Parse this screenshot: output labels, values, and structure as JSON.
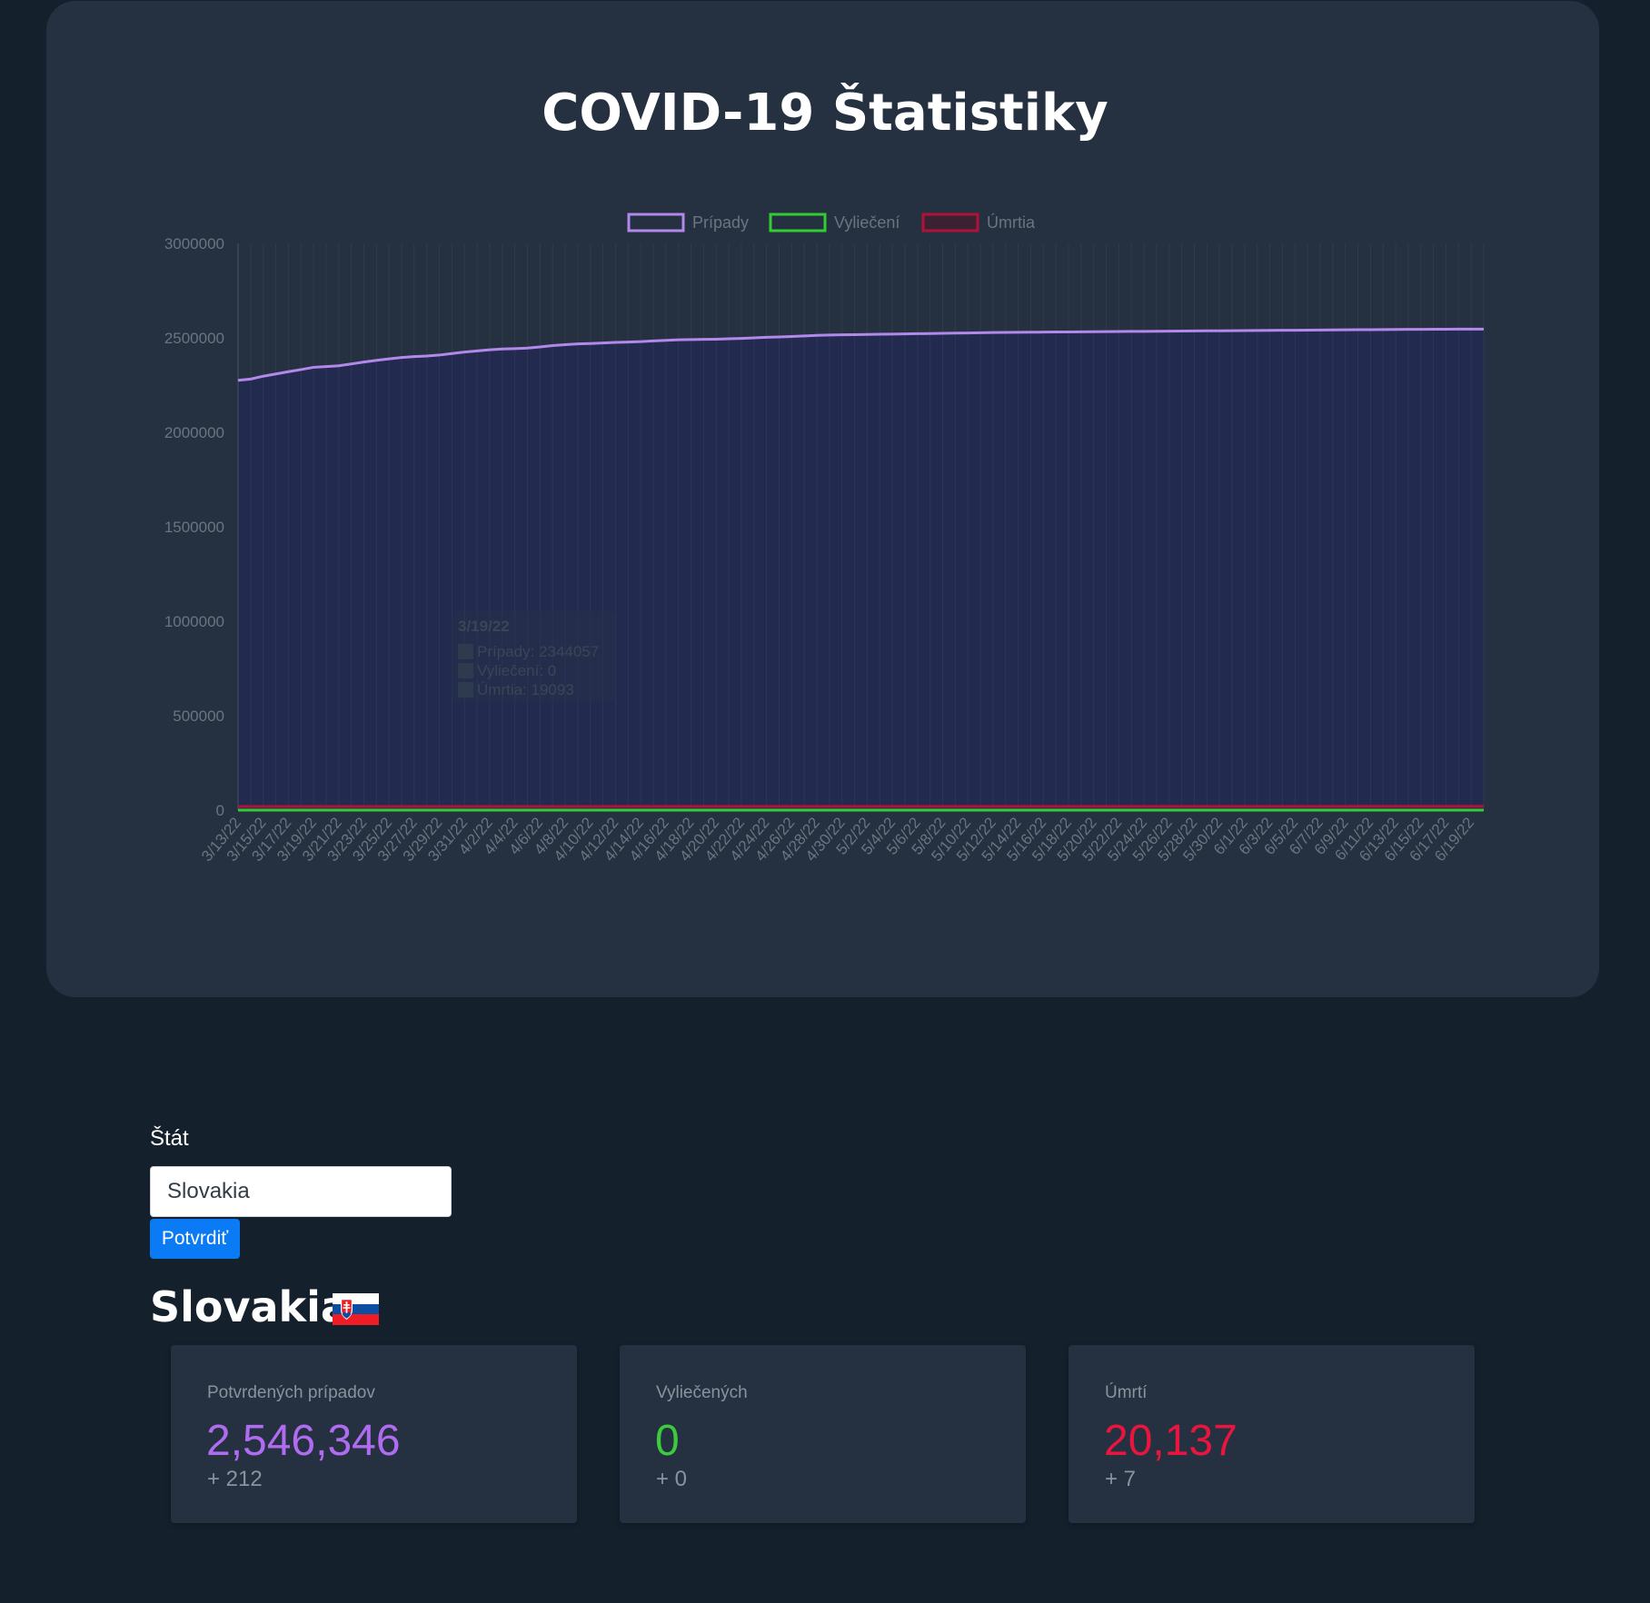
{
  "page": {
    "title": "COVID-19 Štatistiky"
  },
  "chart_data": {
    "type": "area",
    "legend_position": "top",
    "grid": true,
    "ylim": [
      0,
      3000000
    ],
    "yticks": [
      0,
      500000,
      1000000,
      1500000,
      2000000,
      2500000,
      3000000
    ],
    "x": [
      "3/13/22",
      "3/14/22",
      "3/15/22",
      "3/16/22",
      "3/17/22",
      "3/18/22",
      "3/19/22",
      "3/20/22",
      "3/21/22",
      "3/22/22",
      "3/23/22",
      "3/24/22",
      "3/25/22",
      "3/26/22",
      "3/27/22",
      "3/28/22",
      "3/29/22",
      "3/30/22",
      "3/31/22",
      "4/1/22",
      "4/2/22",
      "4/3/22",
      "4/4/22",
      "4/5/22",
      "4/6/22",
      "4/7/22",
      "4/8/22",
      "4/9/22",
      "4/10/22",
      "4/11/22",
      "4/12/22",
      "4/13/22",
      "4/14/22",
      "4/15/22",
      "4/16/22",
      "4/17/22",
      "4/18/22",
      "4/19/22",
      "4/20/22",
      "4/21/22",
      "4/22/22",
      "4/23/22",
      "4/24/22",
      "4/25/22",
      "4/26/22",
      "4/27/22",
      "4/28/22",
      "4/29/22",
      "4/30/22",
      "5/1/22",
      "5/2/22",
      "5/3/22",
      "5/4/22",
      "5/5/22",
      "5/6/22",
      "5/7/22",
      "5/8/22",
      "5/9/22",
      "5/10/22",
      "5/11/22",
      "5/12/22",
      "5/13/22",
      "5/14/22",
      "5/15/22",
      "5/16/22",
      "5/17/22",
      "5/18/22",
      "5/19/22",
      "5/20/22",
      "5/21/22",
      "5/22/22",
      "5/23/22",
      "5/24/22",
      "5/25/22",
      "5/26/22",
      "5/27/22",
      "5/28/22",
      "5/29/22",
      "5/30/22",
      "5/31/22",
      "6/1/22",
      "6/2/22",
      "6/3/22",
      "6/4/22",
      "6/5/22",
      "6/6/22",
      "6/7/22",
      "6/8/22",
      "6/9/22",
      "6/10/22",
      "6/11/22",
      "6/12/22",
      "6/13/22",
      "6/14/22",
      "6/15/22",
      "6/16/22",
      "6/17/22",
      "6/18/22",
      "6/19/22",
      "6/20/22"
    ],
    "series": [
      {
        "name": "Prípady",
        "color": "#b388eb",
        "fill": "#222b4f",
        "values": [
          2275000,
          2282000,
          2297000,
          2309000,
          2321000,
          2332000,
          2344057,
          2348000,
          2352000,
          2362000,
          2372000,
          2381000,
          2389000,
          2396000,
          2401000,
          2404000,
          2409000,
          2417000,
          2425000,
          2431000,
          2437000,
          2441000,
          2443000,
          2446000,
          2452000,
          2459000,
          2464000,
          2468000,
          2470000,
          2473000,
          2476000,
          2478000,
          2480000,
          2484000,
          2487000,
          2490000,
          2491000,
          2492000,
          2493000,
          2495000,
          2497000,
          2500000,
          2503000,
          2505000,
          2507000,
          2510000,
          2513000,
          2515000,
          2516000,
          2517000,
          2518000,
          2519000,
          2520000,
          2521000,
          2522000,
          2523000,
          2524000,
          2525000,
          2526000,
          2527000,
          2528000,
          2529000,
          2529500,
          2530000,
          2530500,
          2531000,
          2531500,
          2532000,
          2532500,
          2533000,
          2533500,
          2534000,
          2534500,
          2535000,
          2535500,
          2536000,
          2536500,
          2537000,
          2537500,
          2538000,
          2538500,
          2539000,
          2539500,
          2540000,
          2540500,
          2541000,
          2541500,
          2542000,
          2542500,
          2543000,
          2543500,
          2544000,
          2544500,
          2545000,
          2545300,
          2545600,
          2545900,
          2546100,
          2546346,
          2546346
        ]
      },
      {
        "name": "Vyliečení",
        "color": "#32cd32",
        "values": [
          0,
          0,
          0,
          0,
          0,
          0,
          0,
          0,
          0,
          0,
          0,
          0,
          0,
          0,
          0,
          0,
          0,
          0,
          0,
          0,
          0,
          0,
          0,
          0,
          0,
          0,
          0,
          0,
          0,
          0,
          0,
          0,
          0,
          0,
          0,
          0,
          0,
          0,
          0,
          0,
          0,
          0,
          0,
          0,
          0,
          0,
          0,
          0,
          0,
          0,
          0,
          0,
          0,
          0,
          0,
          0,
          0,
          0,
          0,
          0,
          0,
          0,
          0,
          0,
          0,
          0,
          0,
          0,
          0,
          0,
          0,
          0,
          0,
          0,
          0,
          0,
          0,
          0,
          0,
          0,
          0,
          0,
          0,
          0,
          0,
          0,
          0,
          0,
          0,
          0,
          0,
          0,
          0,
          0,
          0,
          0,
          0,
          0,
          0,
          0
        ]
      },
      {
        "name": "Úmrtia",
        "color": "#b0113a",
        "values": [
          18950,
          18980,
          19010,
          19035,
          19055,
          19075,
          19093,
          19110,
          19130,
          19150,
          19170,
          19190,
          19210,
          19230,
          19250,
          19270,
          19290,
          19310,
          19330,
          19350,
          19370,
          19390,
          19410,
          19430,
          19450,
          19470,
          19490,
          19510,
          19530,
          19550,
          19570,
          19590,
          19610,
          19630,
          19650,
          19670,
          19690,
          19710,
          19730,
          19750,
          19770,
          19790,
          19810,
          19830,
          19850,
          19870,
          19890,
          19910,
          19930,
          19950,
          19965,
          19980,
          19995,
          20005,
          20015,
          20025,
          20035,
          20045,
          20052,
          20058,
          20064,
          20070,
          20075,
          20080,
          20084,
          20088,
          20091,
          20094,
          20097,
          20100,
          20103,
          20106,
          20108,
          20110,
          20112,
          20114,
          20116,
          20118,
          20120,
          20122,
          20124,
          20125,
          20126,
          20127,
          20128,
          20129,
          20130,
          20131,
          20132,
          20133,
          20133,
          20134,
          20134,
          20135,
          20135,
          20136,
          20136,
          20137,
          20137,
          20137
        ]
      }
    ],
    "tooltip": {
      "title": "3/19/22",
      "lines": [
        "Prípady: 2344057",
        "Vyliečení: 0",
        "Úmrtia: 19093"
      ]
    }
  },
  "form": {
    "label": "Štát",
    "value": "Slovakia",
    "button_label": "Potvrdiť"
  },
  "country": {
    "name": "Slovakia",
    "flag_icon": "flag-slovakia-icon"
  },
  "stats": [
    {
      "label": "Potvrdených prípadov",
      "value": "2,546,346",
      "delta": "+ 212",
      "color": "#b06cf0"
    },
    {
      "label": "Vyliečených",
      "value": "0",
      "delta": "+ 0",
      "color": "#3ccb3c"
    },
    {
      "label": "Úmrtí",
      "value": "20,137",
      "delta": "+ 7",
      "color": "#e8163f"
    }
  ]
}
